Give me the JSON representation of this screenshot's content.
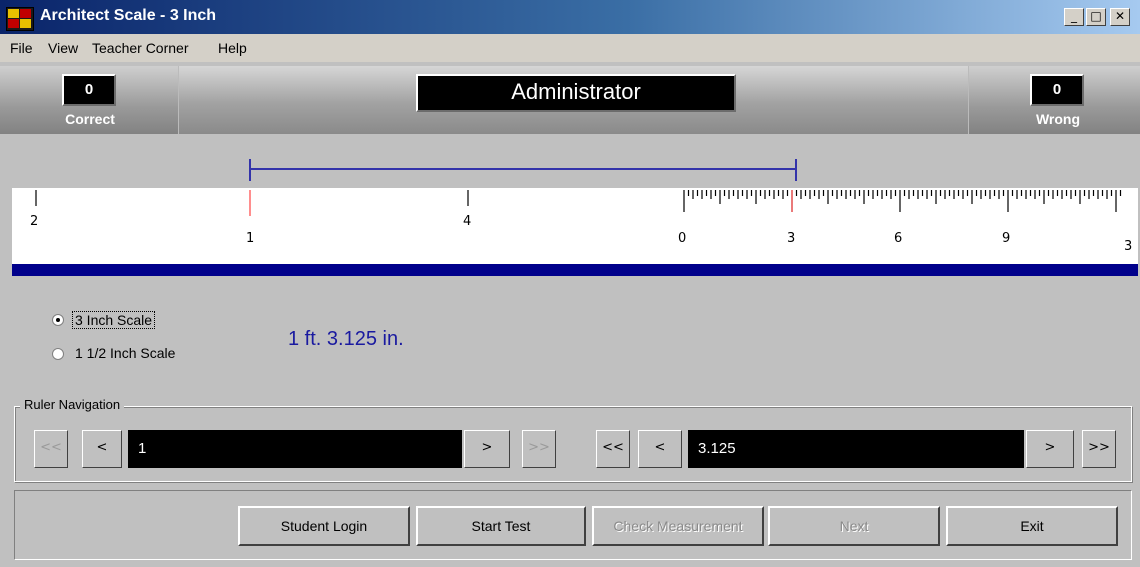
{
  "window": {
    "title": "Architect Scale - 3 Inch",
    "min_glyph": "_",
    "max_glyph": "□",
    "close_glyph": "✕"
  },
  "menu": [
    "File",
    "View",
    "Teacher Corner",
    "Help"
  ],
  "score": {
    "correct_value": "0",
    "correct_label": "Correct",
    "wrong_value": "0",
    "wrong_label": "Wrong",
    "user_name": "Administrator"
  },
  "ruler": {
    "labels": [
      "2",
      "1",
      "4",
      "0",
      "3",
      "6",
      "9",
      "3"
    ],
    "measure_color": "#3333aa",
    "marker_color": "#ff4444",
    "band_color": "#00008b"
  },
  "scale_options": {
    "option1": "3  Inch Scale",
    "option2": "1  1/2  Inch Scale",
    "selected": "3  Inch Scale"
  },
  "measurement_display": "1 ft. 3.125 in.",
  "ruler_navigation": {
    "legend": "Ruler Navigation",
    "left_first": "<<",
    "left_prev": "<",
    "left_value": "1",
    "left_next": ">",
    "left_last": ">>",
    "right_first": "<<",
    "right_prev": "<",
    "right_value": "3.125",
    "right_next": ">",
    "right_last": ">>"
  },
  "buttons": {
    "student_login": "Student Login",
    "start_test": "Start Test",
    "check_measurement": "Check Measurement",
    "next": "Next",
    "exit": "Exit"
  }
}
